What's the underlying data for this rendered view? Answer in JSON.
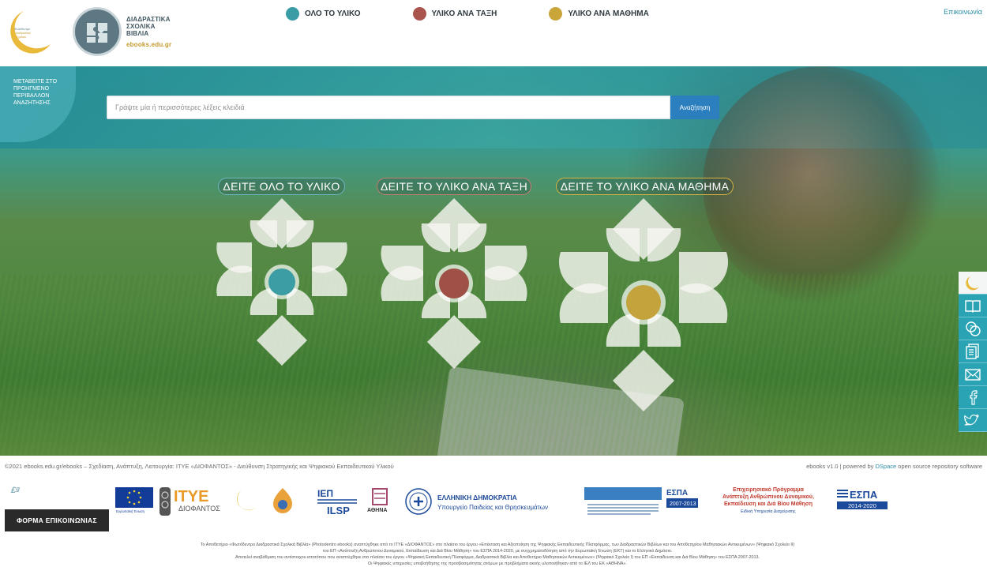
{
  "header": {
    "brand_lines": [
      "ΔΙΑΔΡΑΣΤΙΚΑ",
      "ΣΧΟΛΙΚΑ",
      "ΒΙΒΛΙΑ"
    ],
    "brand_url": "ebooks.edu.gr",
    "logo_a_caption": "Φωτόδεντρο Διαδραστικά Σχολικά Βιβλία",
    "nav": [
      {
        "label": "ΟΛΟ ΤΟ ΥΛΙΚΟ",
        "color": "#3a9da5"
      },
      {
        "label": "ΥΛΙΚΟ ΑΝΑ ΤΑΞΗ",
        "color": "#a9554e"
      },
      {
        "label": "ΥΛΙΚΟ ΑΝΑ ΜΑΘΗΜΑ",
        "color": "#c9a53a"
      }
    ],
    "contact": "Επικοινωνία"
  },
  "hero": {
    "advanced_search": [
      "ΜΕΤΑΒΕΙΤΕ ΣΤΟ",
      "ΠΡΟΗΓΜΕΝΟ",
      "ΠΕΡΙΒΑΛΛΟΝ",
      "ΑΝΑΖΗΤΗΣΗΣ"
    ],
    "search_placeholder": "Γράψτε μία ή περισσότερες λέξεις κλειδιά",
    "search_button": "Αναζήτηση",
    "pills": {
      "all": "ΔΕΙΤΕ ΟΛΟ ΤΟ ΥΛΙΚΟ",
      "class": "ΔΕΙΤΕ ΤΟ ΥΛΙΚΟ ΑΝΑ ΤΑΞΗ",
      "subject": "ΔΕΙΤΕ ΤΟ ΥΛΙΚΟ ΑΝΑ ΜΑΘΗΜΑ"
    },
    "flower_center_colors": [
      "#3c9ea4",
      "#9f5147",
      "#c5a33c"
    ]
  },
  "social": [
    "logo-icon",
    "book-icon",
    "help-icon",
    "document-icon",
    "mail-icon",
    "facebook-icon",
    "twitter-icon"
  ],
  "footer": {
    "credit_left": "©2021 ebooks.edu.gr/ebooks – Σχεδίαση, Ανάπτυξη, Λειτουργία: ΙΤΥΕ «ΔΙΟΦΑΝΤΟΣ» - Διεύθυνση Στρατηγικής και Ψηφιακού Εκπαιδευτικού Υλικού",
    "credit_right_prefix": "ebooks v1.0 | powered by ",
    "credit_right_link": "DSpace",
    "credit_right_suffix": " open source repository software",
    "es_logo": "£ᵍ",
    "contact_button": "ΦΟΡΜΑ ΕΠΙΚΟΙΝΩΝΙΑΣ",
    "sponsors": {
      "eu": "Ευρωπαϊκή Ένωση",
      "itye": "ΙΤΥΕ",
      "diofantos": "ΔΙΟΦΑΝΤΟΣ",
      "iep": "ΙΕΠ",
      "lsp": "ILSP",
      "athina": "ΑΘΗΝΑ",
      "greece_title": "ΕΛΛΗΝΙΚΗ ΔΗΜΟΚΡΑΤΙΑ",
      "greece_sub": "Υπουργείο Παιδείας και Θρησκευμάτων",
      "espa": "ΕΣΠΑ",
      "espa_years_a": "2007-2013",
      "op_title": "Επιχειρησιακό Πρόγραμμα",
      "op_line1": "Ανάπτυξη Ανθρώπινου Δυναμικού,",
      "op_line2": "Εκπαίδευση και Διά Βίου Μάθηση",
      "op_line3": "Ειδική Υπηρεσία Διαχείρισης",
      "espa_years_b": "2014-2020"
    },
    "footnote": [
      "Το Αποθετήριο «Φωτόδεντρο Διαδραστικά Σχολικά Βιβλία» (Photodentro ebooks) αναπτύχθηκε από το ΙΤΥΕ «ΔΙΟΦΑΝΤΟΣ» στο πλαίσιο του έργου «Επέκταση και Αξιοποίηση της Ψηφιακής Εκπαιδευτικής Πλατφόρμας, των Διαδραστικών Βιβλίων και του Αποθετηρίου Μαθησιακών Αντικειμένων» (Ψηφιακό Σχολείο ΙΙ)",
      "του ΕΠ «Ανάπτυξη Ανθρώπινου Δυναμικού, Εκπαίδευση και Διά Βίου Μάθηση» του ΕΣΠΑ 2014-2020, με συγχρηματοδότηση από την Ευρωπαϊκή Ένωση (ΕΚΤ) και το Ελληνικό Δημόσιο.",
      "Αποτελεί αναβάθμιση του αντίστοιχου ιστοτόπου που αναπτύχθηκε στο πλαίσιο του έργου «Ψηφιακή Εκπαιδευτική Πλατφόρμα, Διαδραστικά Βιβλία και Αποθετήριο Μαθησιακών Αντικειμένων» (Ψηφιακό Σχολείο Ι) του ΕΠ «Εκπαίδευση και Διά Βίου Μάθηση» του ΕΣΠΑ 2007-2013.",
      "Οι Ψηφιακές υπηρεσίες υποβοήθησης της προσβασιμότητας ατόμων με προβλήματα ακοής υλοποιήθηκαν από το ΙΕΛ του ΕΚ «ΑΘΗΝΑ»."
    ]
  }
}
